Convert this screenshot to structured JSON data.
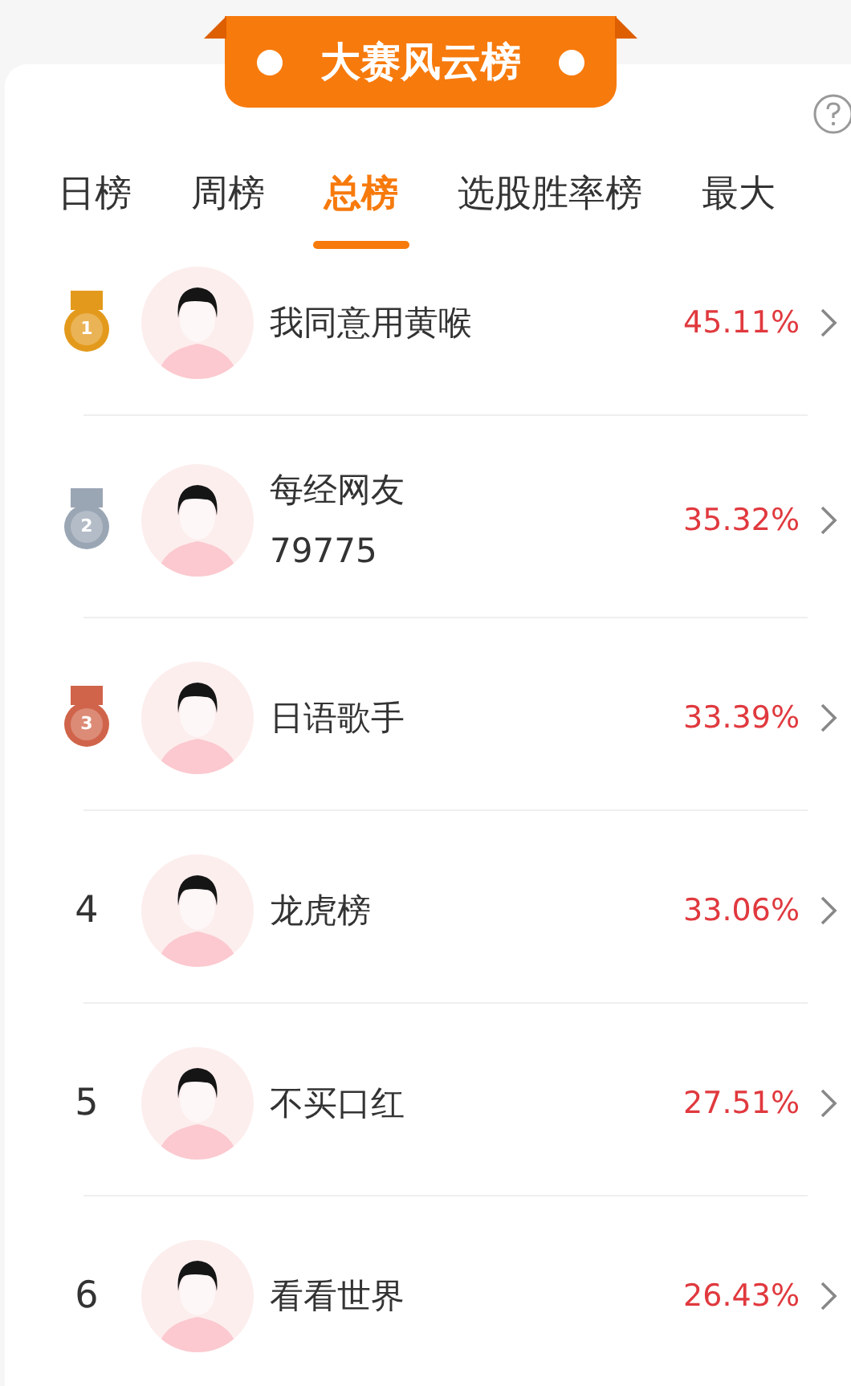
{
  "banner": {
    "title": "大赛风云榜"
  },
  "tabs": [
    {
      "label": "日榜",
      "selected": false
    },
    {
      "label": "周榜",
      "selected": false
    },
    {
      "label": "总榜",
      "selected": true
    },
    {
      "label": "选股胜率榜",
      "selected": false
    },
    {
      "label": "最大",
      "selected": false
    }
  ],
  "rows": [
    {
      "kind": "medal",
      "rank": "1",
      "color": "#e39a1c",
      "name": "我同意用黄喉",
      "rate": "45.11%"
    },
    {
      "kind": "medal",
      "rank": "2",
      "color": "#9aa6b4",
      "name": "每经网友\n79775",
      "rate": "35.32%"
    },
    {
      "kind": "medal",
      "rank": "3",
      "color": "#d0644a",
      "name": "日语歌手",
      "rate": "33.39%"
    },
    {
      "kind": "plain",
      "rank": "4",
      "name": "龙虎榜",
      "rate": "33.06%"
    },
    {
      "kind": "plain",
      "rank": "5",
      "name": "不买口红",
      "rate": "27.51%"
    },
    {
      "kind": "plain",
      "rank": "6",
      "name": "看看世界",
      "rate": "26.43%"
    }
  ]
}
